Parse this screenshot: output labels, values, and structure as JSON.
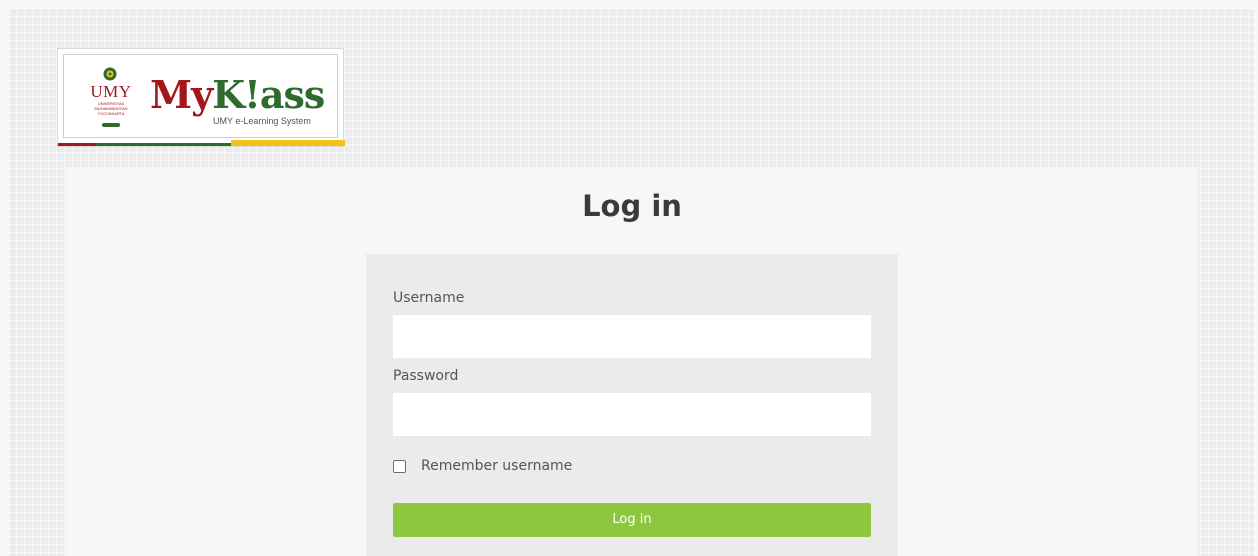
{
  "brand": {
    "umy_text": "UMY",
    "umy_subtext": "UNIVERSITAS MUHAMMADIYAH YOGYAKARTA",
    "name_part1": "My",
    "name_part2": "K!ass",
    "tagline": "UMY e-Learning System",
    "colors": {
      "red": "#a3171b",
      "green": "#2e6b2e",
      "yellow": "#f2c21a"
    }
  },
  "page": {
    "title": "Log in"
  },
  "form": {
    "username_label": "Username",
    "username_value": "",
    "password_label": "Password",
    "password_value": "",
    "remember_label": "Remember username",
    "remember_checked": false,
    "submit_label": "Log in",
    "submit_color": "#8dc63f"
  }
}
